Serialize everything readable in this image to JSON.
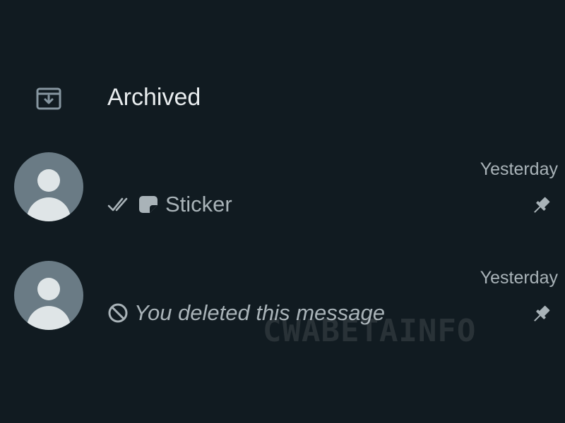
{
  "archived": {
    "label": "Archived",
    "icon": "archive-icon"
  },
  "chats": [
    {
      "timestamp": "Yesterday",
      "preview_text": "Sticker",
      "status_icon": "double-check-icon",
      "type_icon": "sticker-icon",
      "pinned": true
    },
    {
      "timestamp": "Yesterday",
      "preview_text": "You deleted this message",
      "status_icon": "deleted-icon",
      "pinned": true
    }
  ],
  "watermark": "CWABETAINFO",
  "colors": {
    "background": "#111b21",
    "primary_text": "#e9edef",
    "secondary_text": "#a9b3b8",
    "avatar_bg": "#6a7b85",
    "avatar_fg": "#dfe5e7"
  }
}
